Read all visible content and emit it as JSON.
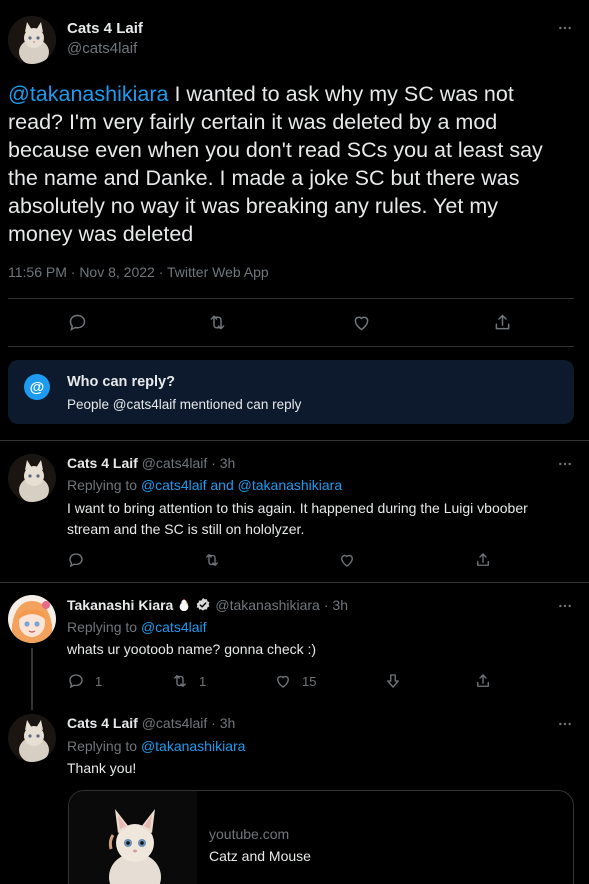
{
  "main_tweet": {
    "author_name": "Cats 4 Laif",
    "author_handle": "@cats4laif",
    "mention": "@takanashikiara",
    "text": " I wanted to ask why my SC was not read? I'm very fairly certain it was deleted by a mod because even when you don't read SCs you at least say the name and Danke. I made a joke SC but there was absolutely no way it was breaking any rules. Yet my money was deleted",
    "timestamp": "11:56 PM · Nov 8, 2022 · Twitter Web App"
  },
  "reply_notice": {
    "title": "Who can reply?",
    "subtitle": "People @cats4laif mentioned can reply",
    "accent": "#1d9bf0",
    "background": "#0d1a2e"
  },
  "replies": [
    {
      "author_name": "Cats 4 Laif",
      "author_handle": "@cats4laif",
      "time": "· 3h",
      "replying_prefix": "Replying to ",
      "replying_to": "@cats4laif and @takanashikiara",
      "text": "I want to bring attention to this again. It happened during the Luigi vboober stream and the SC is still on hololyzer."
    },
    {
      "author_name": "Takanashi Kiara",
      "author_handle": "@takanashikiara",
      "time": "· 3h",
      "replying_prefix": "Replying to ",
      "replying_to": "@cats4laif",
      "text": "whats ur yootoob name? gonna check :)",
      "reply_count": "1",
      "retweet_count": "1",
      "like_count": "15",
      "verified": true
    },
    {
      "author_name": "Cats 4 Laif",
      "author_handle": "@cats4laif",
      "time": "· 3h",
      "replying_prefix": "Replying to ",
      "replying_to": "@takanashikiara",
      "text": "Thank you!",
      "card": {
        "domain": "youtube.com",
        "title": "Catz and Mouse"
      }
    }
  ],
  "icons": [
    "more-icon",
    "reply-icon",
    "retweet-icon",
    "like-icon",
    "share-icon",
    "at-icon",
    "verified-icon",
    "vote-down-icon"
  ]
}
